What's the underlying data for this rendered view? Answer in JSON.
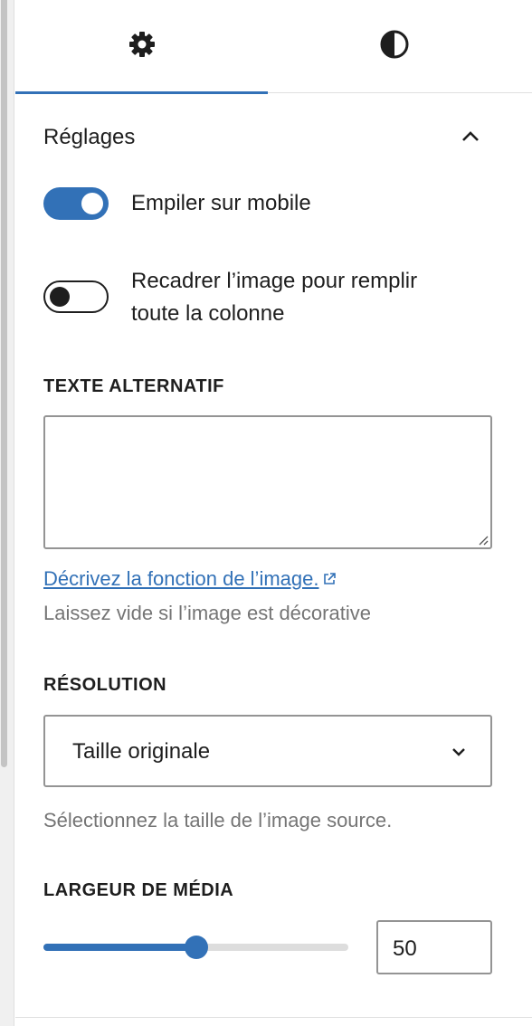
{
  "tabs": [
    {
      "name": "settings",
      "icon": "gear-icon",
      "active": true
    },
    {
      "name": "styles",
      "icon": "half-circle-contrast-icon",
      "active": false
    }
  ],
  "panel": {
    "title": "Réglages",
    "collapse_icon": "chevron-up-icon"
  },
  "toggles": {
    "stack_mobile": {
      "label": "Empiler sur mobile",
      "on": true
    },
    "crop_image": {
      "label_line1": "Recadrer l’image pour remplir",
      "label_line2": "toute la colonne",
      "on": false
    }
  },
  "alt_text": {
    "label": "TEXTE ALTERNATIF",
    "value": "",
    "help_link": "Décrivez la fonction de l’image.",
    "help_link_icon": "external-link-icon",
    "help_text": "Laissez vide si l’image est décorative"
  },
  "resolution": {
    "label": "RÉSOLUTION",
    "selected": "Taille originale",
    "help_text": "Sélectionnez la taille de l’image source."
  },
  "media_width": {
    "label": "LARGEUR DE MÉDIA",
    "value": "50",
    "slider_percent": 50
  },
  "colors": {
    "accent": "#3271b7",
    "text": "#1e1e1e",
    "muted": "#757575",
    "border": "#949494"
  }
}
